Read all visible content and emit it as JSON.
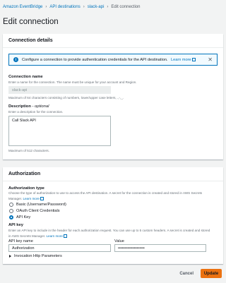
{
  "breadcrumb": {
    "items": [
      "Amazon EventBridge",
      "API destinations",
      "slack-api"
    ],
    "current": "Edit connection"
  },
  "page_title": "Edit connection",
  "connection_details": {
    "header": "Connection details",
    "alert_text": "Configure a connection to provide authentication credentials for the API destination.",
    "alert_link": "Learn more",
    "name_label": "Connection name",
    "name_desc": "Enter a name for the connection. The name must be unique for your account and Region.",
    "name_value": "slack-api",
    "name_constraint": "Maximum of 64 characters consisting of numbers, lower/upper case letters, .,-,_.",
    "desc_label": "Description",
    "desc_optional": "- optional",
    "desc_desc": "Enter a description for the connection.",
    "desc_value": "Call Slack API",
    "desc_constraint": "Maximum of 512 characters."
  },
  "authorization": {
    "header": "Authorization",
    "type_label": "Authorization type",
    "type_desc_line1": "Choose the type of authorization to use to access the API destination. A secret for the connection is created and stored in AWS Secrets",
    "type_desc_line2": "Manager.",
    "type_learn_more": "Learn more",
    "options": [
      "Basic (Username/Password)",
      "OAuth Client Credentials",
      "API Key"
    ],
    "selected_option": "API Key",
    "api_key_label": "API key",
    "api_key_desc_line1": "Enter an API key to include in the header for each authorization request. You can use up to 5 custom headers. A secret is created and stored",
    "api_key_desc_line2": "in AWS Secrets Manager.",
    "api_key_learn_more": "Learn more",
    "key_name_label": "API key name",
    "key_name_value": "Authorization",
    "value_label": "Value",
    "value_value": "••••••••••••••••••••",
    "expander_label": "Invocation Http Parameters"
  },
  "footer": {
    "cancel_label": "Cancel",
    "update_label": "Update"
  },
  "colors": {
    "link": "#0073bb",
    "primary_button": "#ec7211",
    "background": "#f2f3f3"
  }
}
